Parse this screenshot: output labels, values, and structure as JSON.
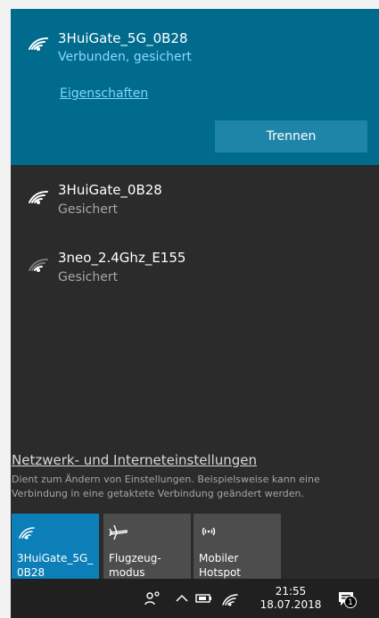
{
  "networks": {
    "connected": {
      "ssid": "3HuiGate_5G_0B28",
      "status": "Verbunden, gesichert",
      "properties_link": "Eigenschaften",
      "disconnect_button": "Trennen"
    },
    "items": [
      {
        "ssid": "3HuiGate_0B28",
        "status": "Gesichert"
      },
      {
        "ssid": "3neo_2.4Ghz_E155",
        "status": "Gesichert"
      }
    ]
  },
  "settings": {
    "link": "Netzwerk- und Interneteinstellungen",
    "description": "Dient zum Ändern von Einstellungen. Beispielsweise kann eine Verbindung in eine getaktete Verbindung geändert werden."
  },
  "quick_actions": [
    {
      "label_line1": "3HuiGate_5G_",
      "label_line2": "0B28",
      "icon": "wifi-icon",
      "active": true
    },
    {
      "label_line1": "Flugzeug-",
      "label_line2": "modus",
      "icon": "airplane-icon",
      "active": false
    },
    {
      "label_line1": "Mobiler",
      "label_line2": "Hotspot",
      "icon": "hotspot-icon",
      "active": false
    }
  ],
  "taskbar": {
    "time": "21:55",
    "date": "18.07.2018",
    "notification_count": "1"
  },
  "colors": {
    "panel": "#2b2b2b",
    "connected_background": "#006b8d",
    "accent": "#0c7fb8",
    "link": "#7fd6ff"
  }
}
